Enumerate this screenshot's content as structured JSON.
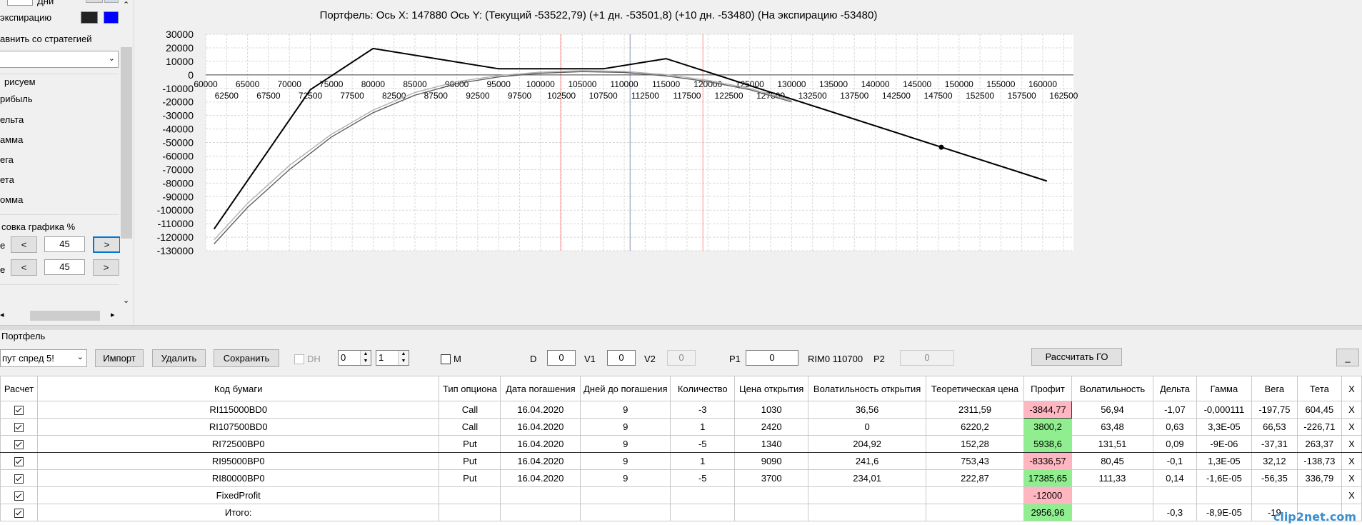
{
  "left_panel": {
    "days_label": "Дни",
    "expiration_label": "экспирацию",
    "compare_label": "авнить со стратегией",
    "draw_label": "рисуем",
    "profit_label": "рибыль",
    "delta_label": "ельта",
    "gamma_label": "амма",
    "vega_label": "ега",
    "theta_label": "ета",
    "vomma_label": "омма",
    "scale_label": "совка графика %",
    "row1_label": "е",
    "row2_label": "е",
    "row1_value": "45",
    "row2_value": "45",
    "prev_label": "<",
    "next_label": ">",
    "colors": {
      "dark": "#222222",
      "blue": "#0000ff"
    }
  },
  "chart": {
    "title": "Портфель: Ось X: 147880 Ось Y:  (Текущий -53522,79)  (+1 дн. -53501,8)  (+10 дн. -53480)  (На экспирацию -53480)"
  },
  "chart_data": {
    "type": "line",
    "title": "Портфель: Ось X: 147880 Ось Y:  (Текущий -53522,79)  (+1 дн. -53501,8)  (+10 дн. -53480)  (На экспирацию -53480)",
    "xlim": [
      60000,
      162500
    ],
    "ylim": [
      -130000,
      30000
    ],
    "x_ticks_top": [
      60000,
      65000,
      70000,
      75000,
      80000,
      85000,
      90000,
      95000,
      100000,
      105000,
      110000,
      115000,
      120000,
      125000,
      130000,
      135000,
      140000,
      145000,
      150000,
      155000,
      160000
    ],
    "x_ticks_bottom": [
      62500,
      67500,
      72500,
      77500,
      82500,
      87500,
      92500,
      97500,
      102500,
      107500,
      112500,
      117500,
      122500,
      127500,
      132500,
      137500,
      142500,
      147500,
      152500,
      157500,
      162500
    ],
    "y_ticks": [
      30000,
      20000,
      10000,
      0,
      -10000,
      -20000,
      -30000,
      -40000,
      -50000,
      -60000,
      -70000,
      -80000,
      -90000,
      -100000,
      -110000,
      -120000,
      -130000
    ],
    "grid": true,
    "vlines": [
      {
        "x": 102400,
        "color": "#ff9999"
      },
      {
        "x": 110700,
        "color": "#8a96a8"
      },
      {
        "x": 119400,
        "color": "#ff9999"
      }
    ],
    "series": [
      {
        "color": "#000000",
        "x": [
          61000,
          72500,
          80000,
          95000,
          107500,
          115000,
          160500
        ],
        "y": [
          -114000,
          -11000,
          19500,
          4500,
          4500,
          12000,
          -78500
        ]
      },
      {
        "color": "#b0b0b0",
        "x": [
          61000,
          65000,
          70000,
          75000,
          80000,
          85000,
          90000,
          95000,
          100000,
          105000,
          110000,
          115000,
          120000,
          125000,
          130000
        ],
        "y": [
          -122000,
          -95000,
          -67000,
          -44000,
          -26000,
          -13000,
          -5000,
          -500,
          2000,
          3200,
          2600,
          200,
          -4000,
          -10000,
          -19000
        ]
      },
      {
        "color": "#606060",
        "x": [
          61000,
          65000,
          70000,
          75000,
          80000,
          85000,
          90000,
          95000,
          100000,
          105000,
          110000,
          115000,
          120000,
          125000,
          130000
        ],
        "y": [
          -125000,
          -98000,
          -70000,
          -46000,
          -28000,
          -15000,
          -6500,
          -1500,
          1200,
          2400,
          1800,
          -800,
          -5000,
          -11000,
          -20000
        ]
      }
    ],
    "marker": {
      "x": 147880,
      "y": -53480
    }
  },
  "portfolio": {
    "label": "Портфель",
    "strategy_value": "пут спред 5!",
    "import_label": "Импорт",
    "delete_label": "Удалить",
    "save_label": "Сохранить",
    "dh_label": "DH",
    "spin1": "0",
    "spin2": "1",
    "m_label": "M",
    "d_label": "D",
    "d_value": "0",
    "v1_label": "V1",
    "v1_value": "0",
    "v2_label": "V2",
    "v2_value": "0",
    "p1_label": "P1",
    "p1_value": "0",
    "rim_label": "RIM0 110700",
    "p2_label": "P2",
    "p2_value": "0",
    "calc_go_label": "Рассчитать ГО",
    "minimize_label": "_"
  },
  "table": {
    "headers": [
      "Расчет",
      "Код бумаги",
      "Тип опциона",
      "Дата погашения",
      "Дней до погашения",
      "Количество",
      "Цена открытия",
      "Волатильность открытия",
      "Теоретическая цена",
      "Профит",
      "Волатильность",
      "Дельта",
      "Гамма",
      "Вега",
      "Тета",
      "X"
    ],
    "rows": [
      {
        "code": "RI115000BD0",
        "type": "Call",
        "date": "16.04.2020",
        "days": "9",
        "qty": "-3",
        "price": "1030",
        "vol_open": "36,56",
        "theo": "2311,59",
        "profit": "-3844,77",
        "profit_sign": "neg",
        "vol": "56,94",
        "delta": "-1,07",
        "gamma": "-0,000111",
        "vega": "-197,75",
        "theta": "604,45",
        "x": "X"
      },
      {
        "code": "RI107500BD0",
        "type": "Call",
        "date": "16.04.2020",
        "days": "9",
        "qty": "1",
        "price": "2420",
        "vol_open": "0",
        "theo": "6220,2",
        "profit": "3800,2",
        "profit_sign": "pos",
        "vol": "63,48",
        "delta": "0,63",
        "gamma": "3,3E-05",
        "vega": "66,53",
        "theta": "-226,71",
        "x": "X"
      },
      {
        "code": "RI72500BP0",
        "type": "Put",
        "date": "16.04.2020",
        "days": "9",
        "qty": "-5",
        "price": "1340",
        "vol_open": "204,92",
        "theo": "152,28",
        "profit": "5938,6",
        "profit_sign": "pos",
        "vol": "131,51",
        "delta": "0,09",
        "gamma": "-9E-06",
        "vega": "-37,31",
        "theta": "263,37",
        "x": "X"
      },
      {
        "code": "RI95000BP0",
        "type": "Put",
        "date": "16.04.2020",
        "days": "9",
        "qty": "1",
        "price": "9090",
        "vol_open": "241,6",
        "theo": "753,43",
        "profit": "-8336,57",
        "profit_sign": "neg",
        "vol": "80,45",
        "delta": "-0,1",
        "gamma": "1,3E-05",
        "vega": "32,12",
        "theta": "-138,73",
        "x": "X"
      },
      {
        "code": "RI80000BP0",
        "type": "Put",
        "date": "16.04.2020",
        "days": "9",
        "qty": "-5",
        "price": "3700",
        "vol_open": "234,01",
        "theo": "222,87",
        "profit": "17385,65",
        "profit_sign": "pos",
        "vol": "111,33",
        "delta": "0,14",
        "gamma": "-1,6E-05",
        "vega": "-56,35",
        "theta": "336,79",
        "x": "X"
      },
      {
        "code": "FixedProfit",
        "type": "",
        "date": "",
        "days": "",
        "qty": "",
        "price": "",
        "vol_open": "",
        "theo": "",
        "profit": "-12000",
        "profit_sign": "neg",
        "vol": "",
        "delta": "",
        "gamma": "",
        "vega": "",
        "theta": "",
        "x": "X"
      },
      {
        "code": "Итого:",
        "type": "",
        "date": "",
        "days": "",
        "qty": "",
        "price": "",
        "vol_open": "",
        "theo": "",
        "profit": "2956,96",
        "profit_sign": "pos",
        "vol": "",
        "delta": "-0,3",
        "gamma": "-8,9E-05",
        "vega": "-19",
        "theta": "",
        "x": ""
      }
    ]
  },
  "watermark": "clip2net.com"
}
